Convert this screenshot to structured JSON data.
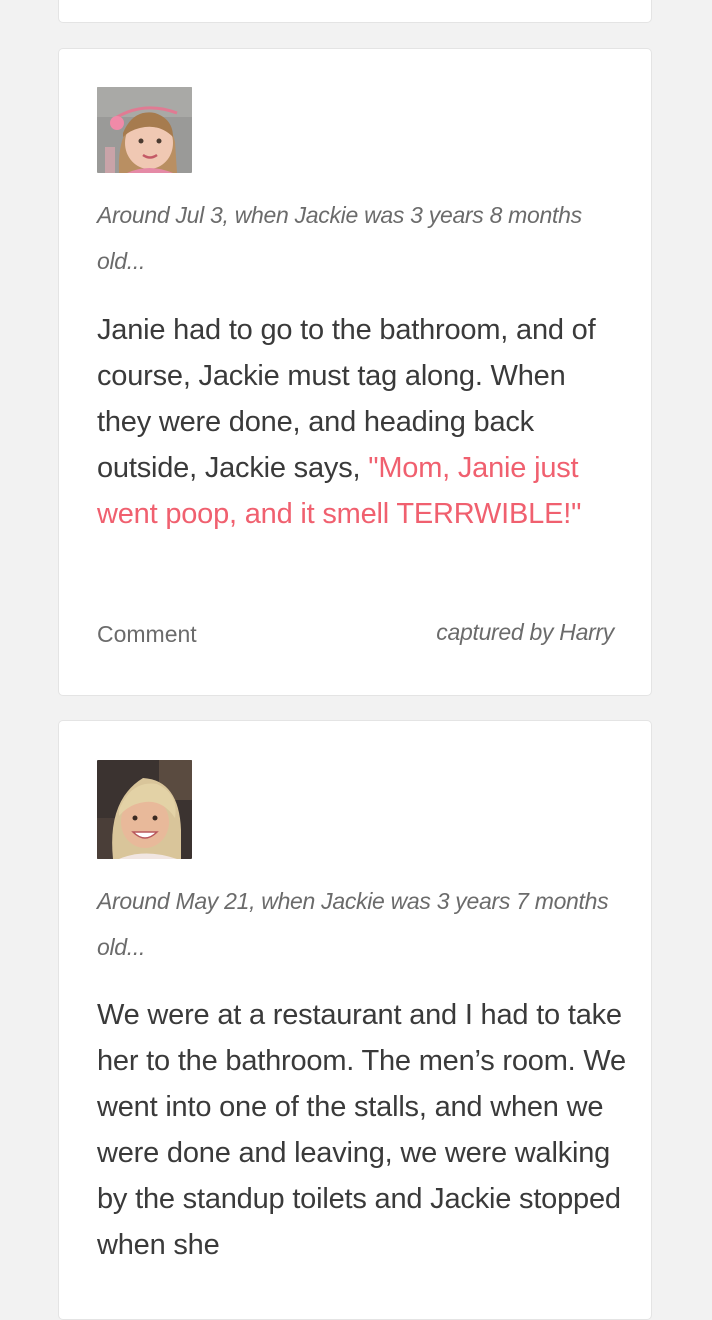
{
  "moments": [
    {
      "context": "Around Jul 3, when Jackie was 3 years 8 months old...",
      "story_before": "Janie had to go to the bathroom, and of course, Jackie must tag along. When they were done, and heading back outside, Jackie says, ",
      "story_quote": "\"Mom, Janie just went poop, and it smell TERRWIBLE!\"",
      "comment_label": "Comment",
      "captured_by": "captured by Harry",
      "quote_color": "#f0606f"
    },
    {
      "context": "Around May 21, when Jackie was 3 years 7 months old...",
      "story_before": "We were at a restaurant and I had to take her to the bathroom. The men’s room. We went into one of the stalls, and when we were done and leaving, we were walking by the standup toilets and Jackie stopped when she"
    }
  ]
}
